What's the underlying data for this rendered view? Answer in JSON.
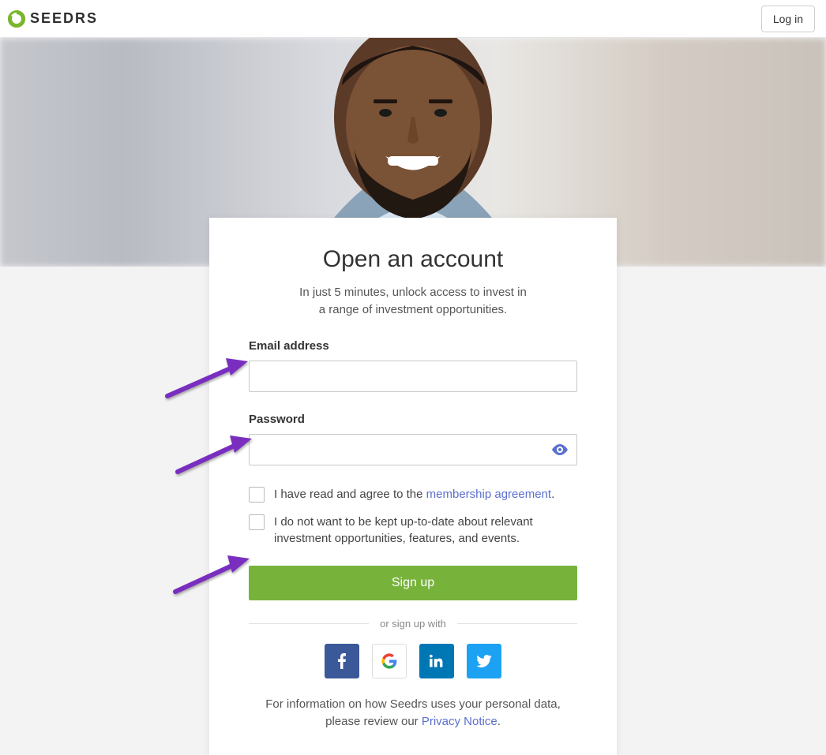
{
  "header": {
    "brand": "SEEDRS",
    "login_label": "Log in"
  },
  "card": {
    "title": "Open an account",
    "subtitle_line1": "In just 5 minutes, unlock access to invest in",
    "subtitle_line2": "a range of investment opportunities.",
    "email_label": "Email address",
    "password_label": "Password",
    "agree_prefix": "I have read and agree to the ",
    "agree_link": "membership agreement",
    "optout_text": "I do not want to be kept up-to-date about relevant investment opportunities, features, and events.",
    "signup_label": "Sign up",
    "divider_label": "or sign up with",
    "footer_prefix": "For information on how Seedrs uses your personal data, please review our ",
    "footer_link": "Privacy Notice"
  }
}
